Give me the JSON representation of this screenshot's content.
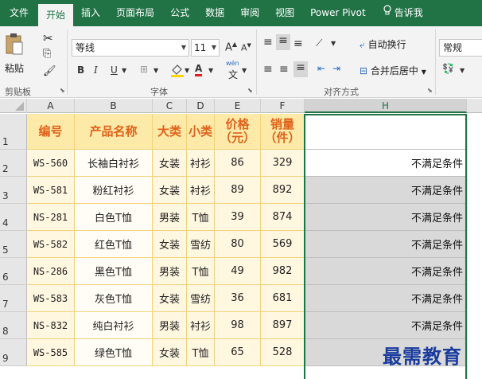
{
  "tabs": [
    {
      "label": "文件"
    },
    {
      "label": "开始"
    },
    {
      "label": "插入"
    },
    {
      "label": "页面布局"
    },
    {
      "label": "公式"
    },
    {
      "label": "数据"
    },
    {
      "label": "审阅"
    },
    {
      "label": "视图"
    },
    {
      "label": "Power Pivot"
    }
  ],
  "search_label": "告诉我",
  "ribbon": {
    "paste_label": "粘贴",
    "clipboard_label": "剪贴板",
    "font_name": "等线",
    "font_size": "11",
    "grow_font": "A",
    "shrink_font": "A",
    "bold": "B",
    "italic": "I",
    "underline": "U",
    "font_color_letter": "A",
    "phonetic": "wén",
    "phonetic_char": "文",
    "font_group_label": "字体",
    "wrap_text": "自动换行",
    "merge_center": "合并后居中",
    "alignment_label": "对齐方式",
    "number_format": "常规"
  },
  "columns": [
    "A",
    "B",
    "C",
    "D",
    "E",
    "F",
    "H"
  ],
  "header_row": {
    "row_number": "1",
    "cells": [
      "编号",
      "产品名称",
      "大类",
      "小类",
      "价格\n（元）",
      "销量\n（件）"
    ]
  },
  "rows": [
    {
      "row_number": "2",
      "cells": [
        "WS-560",
        "长袖白衬衫",
        "女装",
        "衬衫",
        "86",
        "329"
      ],
      "h": "不满足条件"
    },
    {
      "row_number": "3",
      "cells": [
        "WS-581",
        "粉红衬衫",
        "女装",
        "衬衫",
        "89",
        "892"
      ],
      "h": "不满足条件"
    },
    {
      "row_number": "4",
      "cells": [
        "NS-281",
        "白色T恤",
        "男装",
        "T恤",
        "39",
        "874"
      ],
      "h": "不满足条件"
    },
    {
      "row_number": "5",
      "cells": [
        "WS-582",
        "红色T恤",
        "女装",
        "雪纺",
        "80",
        "569"
      ],
      "h": "不满足条件"
    },
    {
      "row_number": "6",
      "cells": [
        "NS-286",
        "黑色T恤",
        "男装",
        "T恤",
        "49",
        "982"
      ],
      "h": "不满足条件"
    },
    {
      "row_number": "7",
      "cells": [
        "WS-583",
        "灰色T恤",
        "女装",
        "雪纺",
        "36",
        "681"
      ],
      "h": "不满足条件"
    },
    {
      "row_number": "8",
      "cells": [
        "NS-832",
        "纯白衬衫",
        "男装",
        "衬衫",
        "98",
        "897"
      ],
      "h": "不满足条件"
    },
    {
      "row_number": "9",
      "cells": [
        "WS-585",
        "绿色T恤",
        "女装",
        "T恤",
        "65",
        "528"
      ],
      "h": ""
    }
  ],
  "watermark": "最需教育",
  "colors": {
    "accent": "#217346",
    "header_text": "#e0621a",
    "header_fill": "#fde9a8",
    "cell_fill": "#fff7e0"
  }
}
